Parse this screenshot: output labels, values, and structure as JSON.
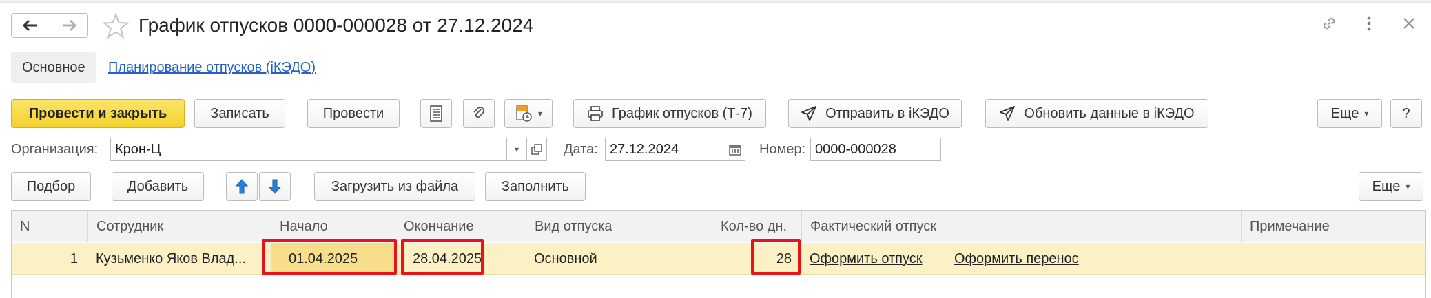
{
  "window": {
    "title": "График отпусков 0000-000028 от 27.12.2024"
  },
  "tabs": {
    "main": "Основное",
    "link": "Планирование отпусков (iКЭДО)"
  },
  "toolbar": {
    "post_close": "Провести и закрыть",
    "save": "Записать",
    "post": "Провести",
    "print_t7": "График отпусков (Т-7)",
    "send_ikedo": "Отправить в iКЭДО",
    "update_ikedo": "Обновить данные в iКЭДО",
    "more": "Еще",
    "help": "?"
  },
  "form": {
    "org_label": "Организация:",
    "org_value": "Крон-Ц",
    "date_label": "Дата:",
    "date_value": "27.12.2024",
    "number_label": "Номер:",
    "number_value": "0000-000028"
  },
  "table_toolbar": {
    "select": "Подбор",
    "add": "Добавить",
    "load_file": "Загрузить из файла",
    "fill": "Заполнить",
    "more": "Еще"
  },
  "table": {
    "columns": [
      "N",
      "Сотрудник",
      "Начало",
      "Окончание",
      "Вид отпуска",
      "Кол-во дн.",
      "Фактический отпуск",
      "Примечание"
    ],
    "rows": [
      {
        "n": "1",
        "employee": "Кузьменко Яков Влад...",
        "start": "01.04.2025",
        "end": "28.04.2025",
        "type": "Основной",
        "days": "28",
        "actual_link1": "Оформить отпуск",
        "actual_link2": "Оформить перенос",
        "note": ""
      }
    ]
  },
  "colors": {
    "primary_button": "#f4d22c",
    "link": "#2660c4",
    "selected_row": "#fbf1c4",
    "highlight_box": "#e8141a"
  }
}
